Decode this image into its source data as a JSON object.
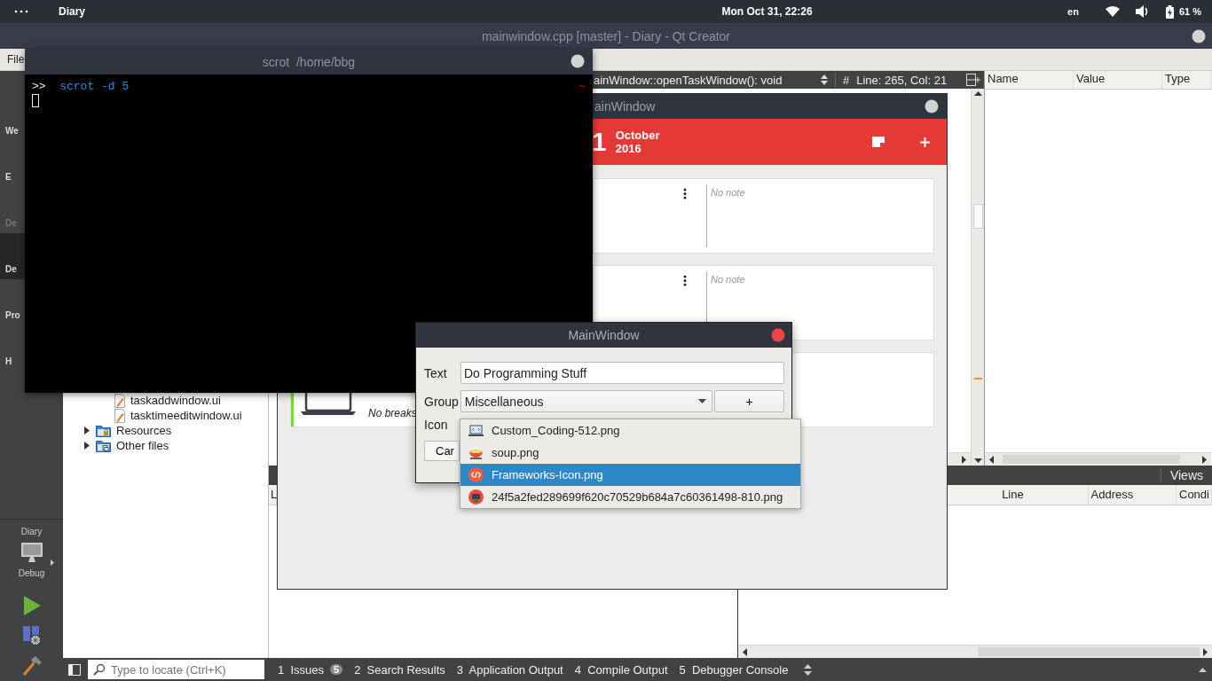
{
  "top_bar": {
    "app": "Diary",
    "clock": "Mon Oct 31, 22:26",
    "keyboard": "en",
    "battery_text": "61 %"
  },
  "ide": {
    "title": "mainwindow.cpp [master] - Diary - Qt Creator",
    "menu": [
      "File"
    ],
    "modes": [
      {
        "label": "We",
        "selected": false,
        "disabled": false
      },
      {
        "label": "E",
        "selected": false,
        "disabled": false
      },
      {
        "label": "De",
        "selected": false,
        "disabled": true
      },
      {
        "label": "De",
        "selected": true,
        "disabled": false
      },
      {
        "label": "Pro",
        "selected": false,
        "disabled": false
      },
      {
        "label": "H",
        "selected": false,
        "disabled": false
      }
    ],
    "target": {
      "project": "Diary",
      "config": "Debug"
    },
    "tree": {
      "form_files": [
        "taskaddwindow.ui",
        "tasktimeeditwindow.ui"
      ],
      "folders": [
        {
          "label": "Resources",
          "kind": "resources",
          "expanded": false
        },
        {
          "label": "Other files",
          "kind": "other",
          "expanded": false
        }
      ]
    },
    "editor_toolbar": {
      "function": "ainWindow::openTaskWindow(): void",
      "hash": "#",
      "position": "Line: 265, Col: 21"
    },
    "locals": {
      "columns": [
        "Name",
        "Value",
        "Type"
      ]
    },
    "breakpoints": {
      "views": "Views",
      "columns": [
        "L",
        "Line",
        "Address",
        "Condi"
      ]
    },
    "locate": {
      "placeholder": "Type to locate (Ctrl+K)"
    },
    "output_tabs": [
      {
        "number": "1",
        "label": "Issues",
        "badge": "5"
      },
      {
        "number": "2",
        "label": "Search Results"
      },
      {
        "number": "3",
        "label": "Application Output"
      },
      {
        "number": "4",
        "label": "Compile Output"
      },
      {
        "number": "5",
        "label": "Debugger Console"
      }
    ]
  },
  "diary": {
    "title": "ainWindow",
    "day": "1",
    "month": "October",
    "year": "2016",
    "tasks": [
      {
        "note": "No note"
      },
      {
        "note": "No note"
      },
      {
        "breaks": "No breaks",
        "color": "#76e01a"
      }
    ]
  },
  "terminal": {
    "title": "scrot  /home/bbg",
    "prompt": ">>",
    "command": "scrot -d 5",
    "cwd": "~"
  },
  "dialog": {
    "title": "MainWindow",
    "text_label": "Text",
    "text_value": "Do Programming Stuff",
    "group_label": "Group",
    "group_value": "Miscellaneous",
    "add_button": "+",
    "icon_label": "Icon",
    "cancel_button": "Car"
  },
  "icon_menu": {
    "items": [
      {
        "label": "Custom_Coding-512.png",
        "kind": "laptop",
        "selected": false
      },
      {
        "label": "soup.png",
        "kind": "bowl",
        "selected": false
      },
      {
        "label": "Frameworks-Icon.png",
        "kind": "code",
        "selected": true
      },
      {
        "label": "24f5a2fed289699f620c70529b684a7c60361498-810.png",
        "kind": "monitor",
        "selected": false
      }
    ]
  }
}
